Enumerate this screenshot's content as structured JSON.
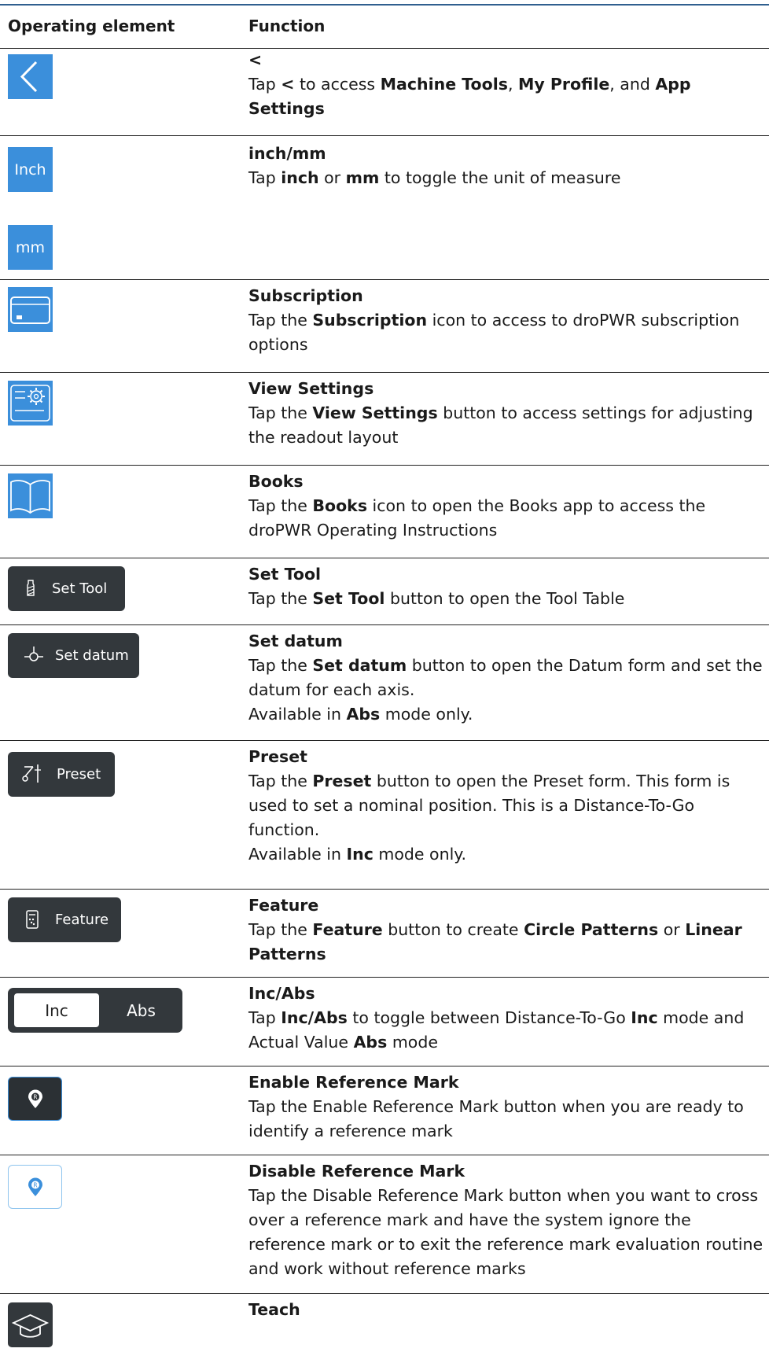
{
  "header": {
    "col1": "Operating element",
    "col2": "Function"
  },
  "rows": [
    {
      "title": "<",
      "parts": [
        [
          "Tap ",
          false
        ],
        [
          "<",
          true
        ],
        [
          " to access ",
          false
        ],
        [
          "Machine Tools",
          true
        ],
        [
          ", ",
          false
        ],
        [
          "My Profile",
          true
        ],
        [
          ", and ",
          false
        ],
        [
          "App Settings",
          true
        ]
      ]
    },
    {
      "title": "inch/mm",
      "tile1": "Inch",
      "tile2": "mm",
      "parts": [
        [
          "Tap ",
          false
        ],
        [
          "inch",
          true
        ],
        [
          " or ",
          false
        ],
        [
          "mm",
          true
        ],
        [
          " to toggle the unit of measure",
          false
        ]
      ]
    },
    {
      "title": "Subscription",
      "parts": [
        [
          "Tap the ",
          false
        ],
        [
          "Subscription",
          true
        ],
        [
          " icon to access to droPWR subscription options",
          false
        ]
      ]
    },
    {
      "title": "View Settings",
      "parts": [
        [
          "Tap the ",
          false
        ],
        [
          "View Settings",
          true
        ],
        [
          " button to access settings for adjusting the readout layout",
          false
        ]
      ]
    },
    {
      "title": "Books",
      "parts": [
        [
          "Tap the ",
          false
        ],
        [
          "Books",
          true
        ],
        [
          " icon to open the Books app to access the droPWR Operating Instructions",
          false
        ]
      ]
    },
    {
      "title": "Set Tool",
      "button": "Set Tool",
      "parts": [
        [
          "Tap the ",
          false
        ],
        [
          "Set Tool",
          true
        ],
        [
          " button to open the Tool Table",
          false
        ]
      ]
    },
    {
      "title": "Set datum",
      "button": "Set datum",
      "parts": [
        [
          "Tap the ",
          false
        ],
        [
          "Set datum",
          true
        ],
        [
          " button to open the Datum form and set the datum for each axis.",
          false
        ],
        [
          "\n",
          false
        ],
        [
          "Available in ",
          false
        ],
        [
          "Abs",
          true
        ],
        [
          " mode only.",
          false
        ]
      ]
    },
    {
      "title": "Preset",
      "button": "Preset",
      "parts": [
        [
          "Tap the ",
          false
        ],
        [
          "Preset",
          true
        ],
        [
          " button to open the Preset form. This form is used to set a nominal position. This is a Distance-To-Go function.",
          false
        ],
        [
          "\n",
          false
        ],
        [
          "Available in ",
          false
        ],
        [
          "Inc",
          true
        ],
        [
          " mode only.",
          false
        ]
      ]
    },
    {
      "title": "Feature",
      "button": "Feature",
      "parts": [
        [
          "Tap the ",
          false
        ],
        [
          "Feature",
          true
        ],
        [
          " button to create ",
          false
        ],
        [
          "Circle Patterns",
          true
        ],
        [
          " or ",
          false
        ],
        [
          "Linear Patterns",
          true
        ]
      ]
    },
    {
      "title": "Inc/Abs",
      "seg_on": "Inc",
      "seg_off": "Abs",
      "parts": [
        [
          "Tap ",
          false
        ],
        [
          "Inc/Abs",
          true
        ],
        [
          " to toggle between Distance-To-Go ",
          false
        ],
        [
          "Inc",
          true
        ],
        [
          " mode and Actual Value ",
          false
        ],
        [
          "Abs",
          true
        ],
        [
          " mode",
          false
        ]
      ]
    },
    {
      "title": "Enable Reference Mark",
      "parts": [
        [
          "Tap the Enable Reference Mark button when you are ready to identify a reference mark",
          false
        ]
      ]
    },
    {
      "title": "Disable Reference Mark",
      "parts": [
        [
          "Tap the Disable Reference Mark button when you want to cross over a reference mark and have the system ignore the reference mark or to exit the reference mark evaluation routine and work without reference marks",
          false
        ]
      ]
    },
    {
      "title": "Teach",
      "parts": []
    }
  ],
  "colors": {
    "icon_blue": "#3b8fdb",
    "button_dark": "#33383c",
    "rule": "#2f5f8f"
  },
  "icons": [
    "chevron-left-icon",
    "subscription-card-icon",
    "view-settings-icon",
    "books-icon",
    "tool-icon",
    "datum-icon",
    "preset-icon",
    "feature-icon",
    "reference-mark-icon",
    "teach-icon"
  ]
}
